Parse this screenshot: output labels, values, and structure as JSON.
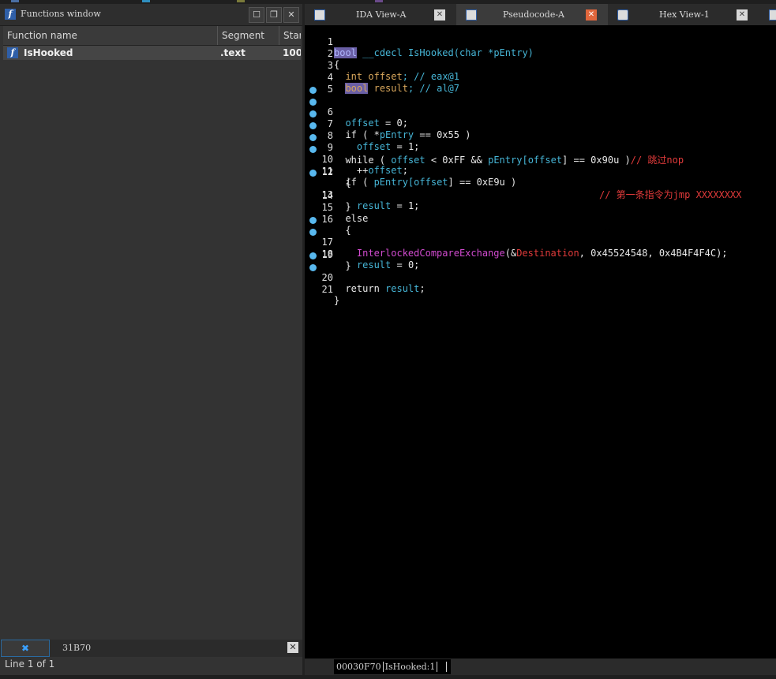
{
  "functions_window": {
    "title": "Functions window",
    "columns": [
      "Function name",
      "Segment",
      "Star"
    ],
    "rows": [
      {
        "name": "IsHooked",
        "segment": ".text",
        "start": "100:"
      }
    ],
    "filter_value": "31B70",
    "status": "Line 1 of 1"
  },
  "tabs": [
    {
      "label": "IDA View-A",
      "icon": "ida-view-icon"
    },
    {
      "label": "Pseudocode-A",
      "icon": "pseudocode-icon",
      "active": true
    },
    {
      "label": "Hex View-1",
      "icon": "hex-view-icon"
    }
  ],
  "code": {
    "lines": [
      {
        "n": "1",
        "bp": false
      },
      {
        "n": "2",
        "bp": false
      },
      {
        "n": "3",
        "bp": false
      },
      {
        "n": "4",
        "bp": false
      },
      {
        "n": "5",
        "bp": false
      },
      {
        "n": "6",
        "bp": true
      },
      {
        "n": "7",
        "bp": true
      },
      {
        "n": "8",
        "bp": true
      },
      {
        "n": "9",
        "bp": true
      },
      {
        "n": "10",
        "bp": true
      },
      {
        "n": "11",
        "bp": true
      },
      {
        "n": "12",
        "bp": false
      },
      {
        "n": "13",
        "bp": true
      },
      {
        "n": "14",
        "bp": false
      },
      {
        "n": "15",
        "bp": false
      },
      {
        "n": "16",
        "bp": false
      },
      {
        "n": "17",
        "bp": true
      },
      {
        "n": "18",
        "bp": true
      },
      {
        "n": "19",
        "bp": false
      },
      {
        "n": "20",
        "bp": true
      },
      {
        "n": "21",
        "bp": true
      }
    ],
    "tokens": {
      "bool": "bool",
      "cdecl": "__cdecl",
      "func_name": "IsHooked",
      "sig_rest": "(char *pEntry)",
      "int": "int",
      "offset": "offset",
      "result": "result",
      "semi_cmt": "; //",
      "eax1": "eax@1",
      "al7": "al@7",
      "assign0": " = 0;",
      "assign1": " = 1;",
      "if_open": "if ( ",
      "star": "*",
      "pEntry": "pEntry",
      "eq_55": " == 0x55 )",
      "while_open": "while ( ",
      "lt_ff": " < 0xFF && ",
      "eq_90": "] == 0x90u )",
      "cmt_skip_nop": "// 跳过nop",
      "inc": "++",
      "eq_e9": "] == 0xE9u )",
      "cmt_first": "// 第一条指令为jmp XXXXXXXX",
      "lbrace": "{",
      "rbrace": "}",
      "else": "else",
      "icx": "InterlockedCompareExchange",
      "amp": "(&",
      "dest": "Destination",
      "icx_args": ", 0x45524548, 0x4B4F4F4C);",
      "return": "return ",
      "semi": ";",
      "lbr": "[",
      "space": " "
    }
  },
  "status_bar": {
    "address": "00030F70",
    "location": "IsHooked:1"
  }
}
